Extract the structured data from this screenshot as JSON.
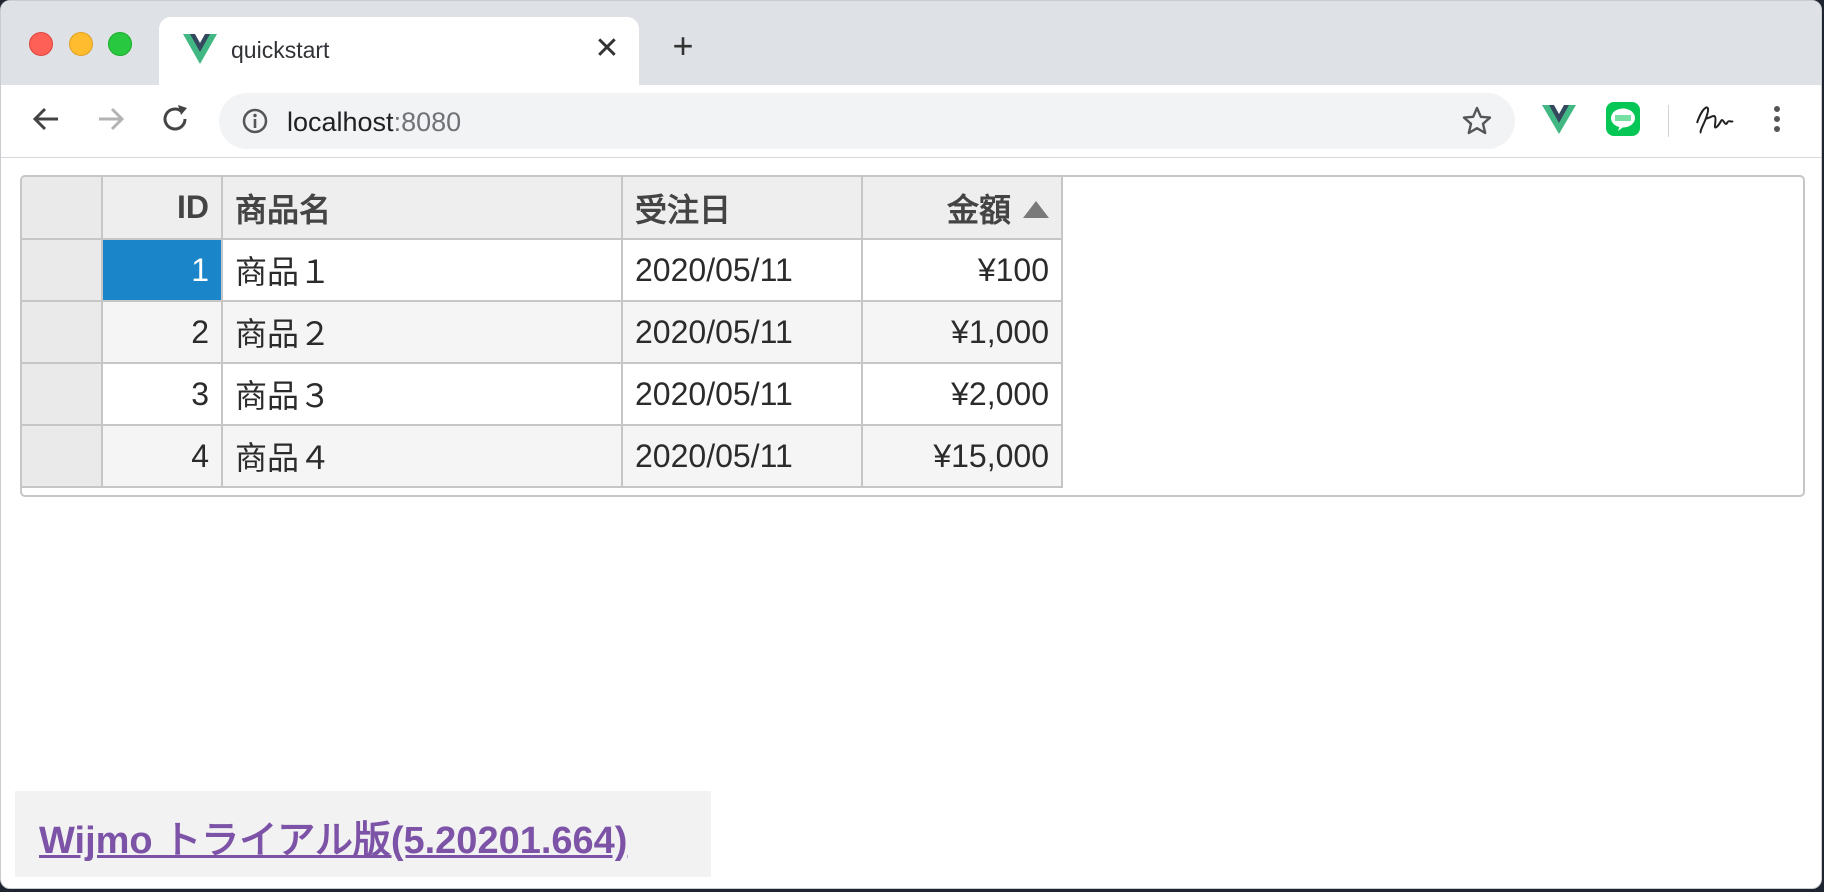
{
  "browser": {
    "tab_title": "quickstart",
    "tab_close_glyph": "✕",
    "new_tab_glyph": "+",
    "url_host": "localhost",
    "url_port": ":8080"
  },
  "grid": {
    "headers": {
      "id": "ID",
      "name": "商品名",
      "date": "受注日",
      "amount": "金額"
    },
    "rows": [
      {
        "id": "1",
        "name": "商品１",
        "date": "2020/05/11",
        "amount": "¥100"
      },
      {
        "id": "2",
        "name": "商品２",
        "date": "2020/05/11",
        "amount": "¥1,000"
      },
      {
        "id": "3",
        "name": "商品３",
        "date": "2020/05/11",
        "amount": "¥2,000"
      },
      {
        "id": "4",
        "name": "商品４",
        "date": "2020/05/11",
        "amount": "¥15,000"
      }
    ],
    "sort": {
      "column": "amount",
      "direction": "ascending"
    },
    "selected_cell": {
      "row": 0,
      "column": "id"
    },
    "selection_color": "#1a86c9"
  },
  "footer": {
    "trial_link": "Wijmo トライアル版(5.20201.664)",
    "link_color": "#7c53a6"
  },
  "icons": [
    "vue-icon",
    "close-icon",
    "plus-icon",
    "back-arrow-icon",
    "forward-arrow-icon",
    "reload-icon",
    "info-icon",
    "star-icon",
    "line-extension-icon",
    "signature-extension-icon",
    "more-menu-icon",
    "sort-ascending-icon"
  ]
}
